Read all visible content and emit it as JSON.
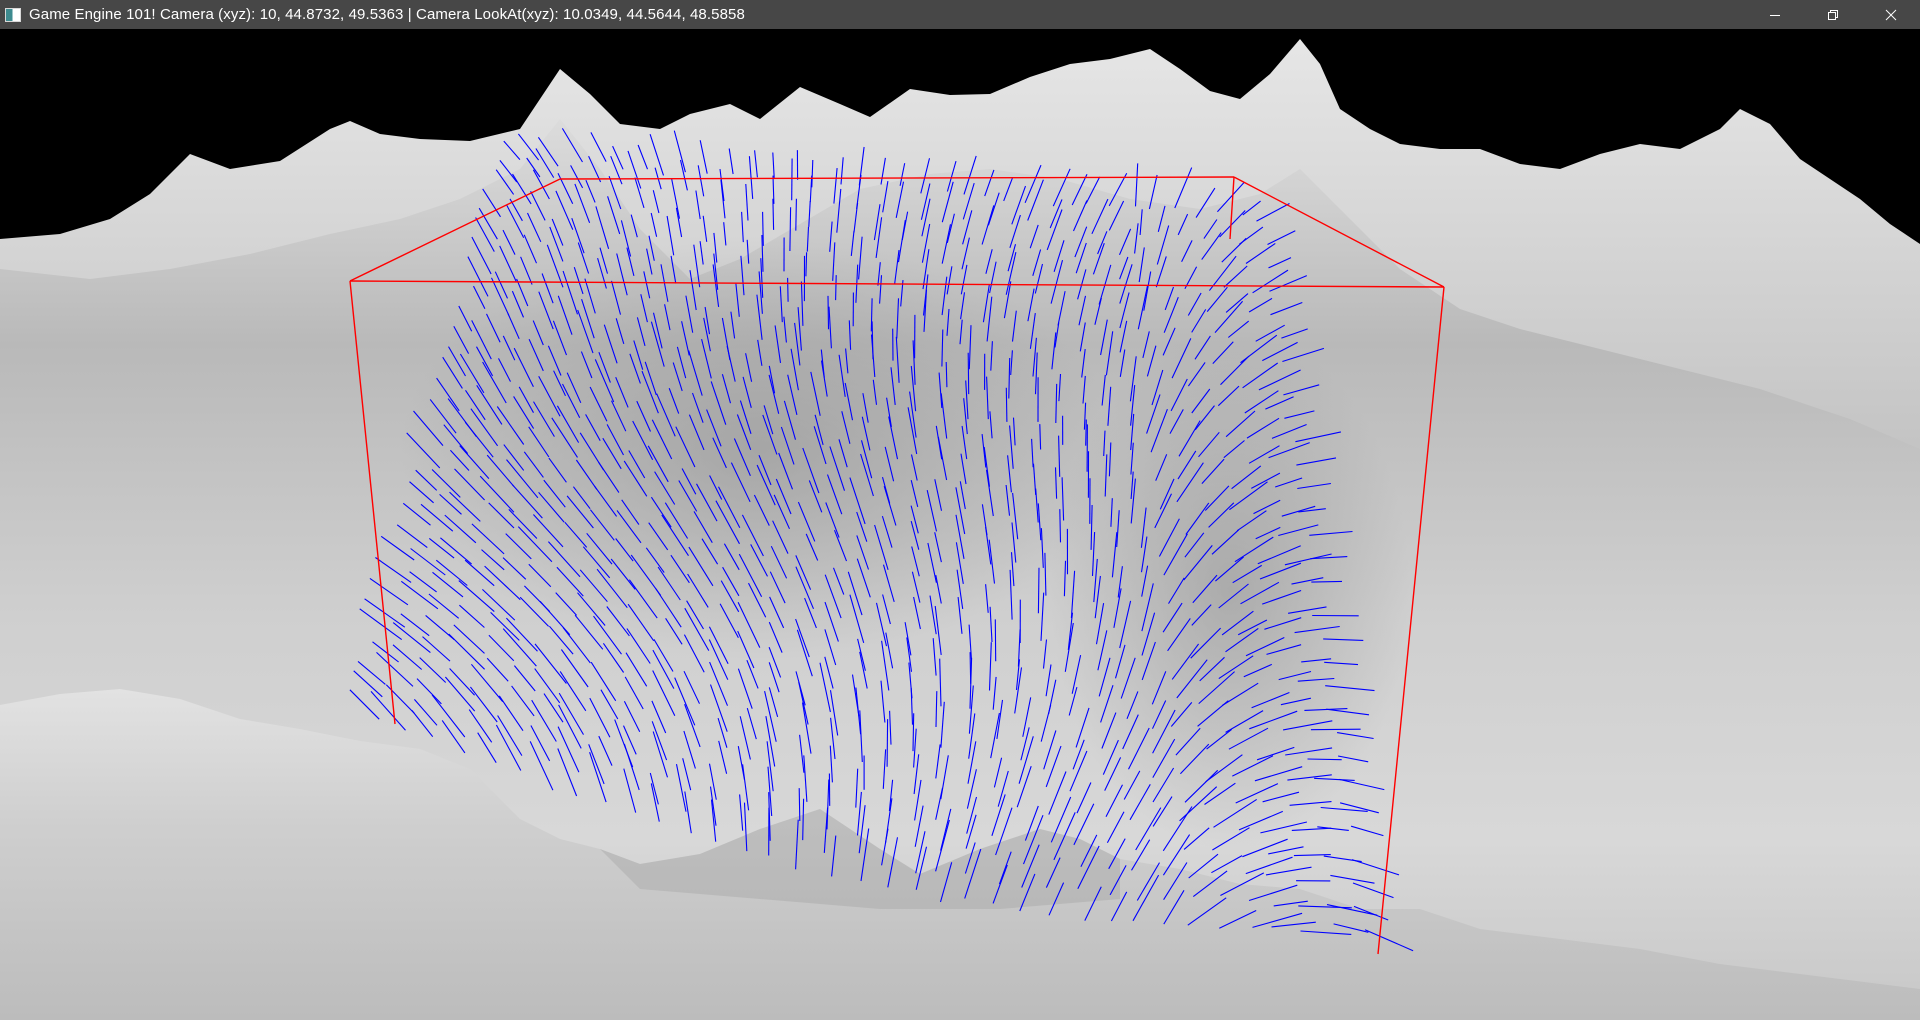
{
  "window": {
    "title": "Game Engine 101! Camera (xyz): 10, 44.8732, 49.5363 | Camera LookAt(xyz): 10.0349, 44.5644, 48.5858",
    "app_icon": "app-window-icon",
    "buttons": [
      {
        "name": "minimize-button",
        "icon": "minimize-icon"
      },
      {
        "name": "restore-button",
        "icon": "restore-icon"
      },
      {
        "name": "close-button",
        "icon": "close-icon"
      }
    ]
  },
  "scene": {
    "sky_color": "#000000",
    "terrain_color": "#c8c8c8",
    "bounding_box_color": "#ff0000",
    "vector_color": "#0000ff"
  }
}
